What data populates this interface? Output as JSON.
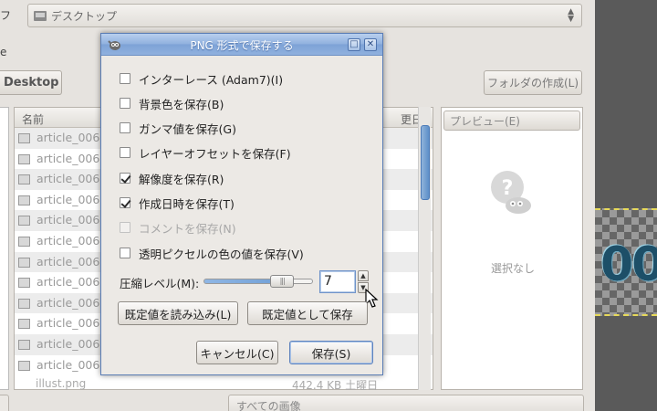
{
  "background_dialog": {
    "location_label": "フ",
    "location_value": "デスクトップ",
    "left_label": "e",
    "desktop_button": "Desktop",
    "new_folder_button": "フォルダの作成(L)",
    "column_name": "名前",
    "column_modified": "更日",
    "file_rows": [
      "article_006",
      "article_006",
      "article_006",
      "article_006",
      "article_006",
      "article_006",
      "article_006",
      "article_006",
      "article_006",
      "article_006",
      "article_006",
      "article_006"
    ],
    "last_row": {
      "name": "illust.png",
      "info": "442.4 KB 土曜日"
    },
    "preview_button": "プレビュー(E)",
    "preview_text": "選択なし",
    "filter_value": "すべての画像"
  },
  "png_dialog": {
    "title": "PNG 形式で保存する",
    "options": [
      {
        "label": "インターレース (Adam7)(I)",
        "checked": false,
        "enabled": true
      },
      {
        "label": "背景色を保存(B)",
        "checked": false,
        "enabled": true
      },
      {
        "label": "ガンマ値を保存(G)",
        "checked": false,
        "enabled": true
      },
      {
        "label": "レイヤーオフセットを保存(F)",
        "checked": false,
        "enabled": true
      },
      {
        "label": "解像度を保存(R)",
        "checked": true,
        "enabled": true
      },
      {
        "label": "作成日時を保存(T)",
        "checked": true,
        "enabled": true
      },
      {
        "label": "コメントを保存(N)",
        "checked": false,
        "enabled": false
      },
      {
        "label": "透明ピクセルの色の値を保存(V)",
        "checked": false,
        "enabled": true
      }
    ],
    "compression_label": "圧縮レベル(M):",
    "compression_value": "7",
    "compression_max": 9,
    "load_defaults_button": "既定値を読み込み(L)",
    "save_defaults_button": "既定値として保存",
    "cancel_button": "キャンセル(C)",
    "save_button": "保存(S)"
  },
  "canvas_text": "00"
}
